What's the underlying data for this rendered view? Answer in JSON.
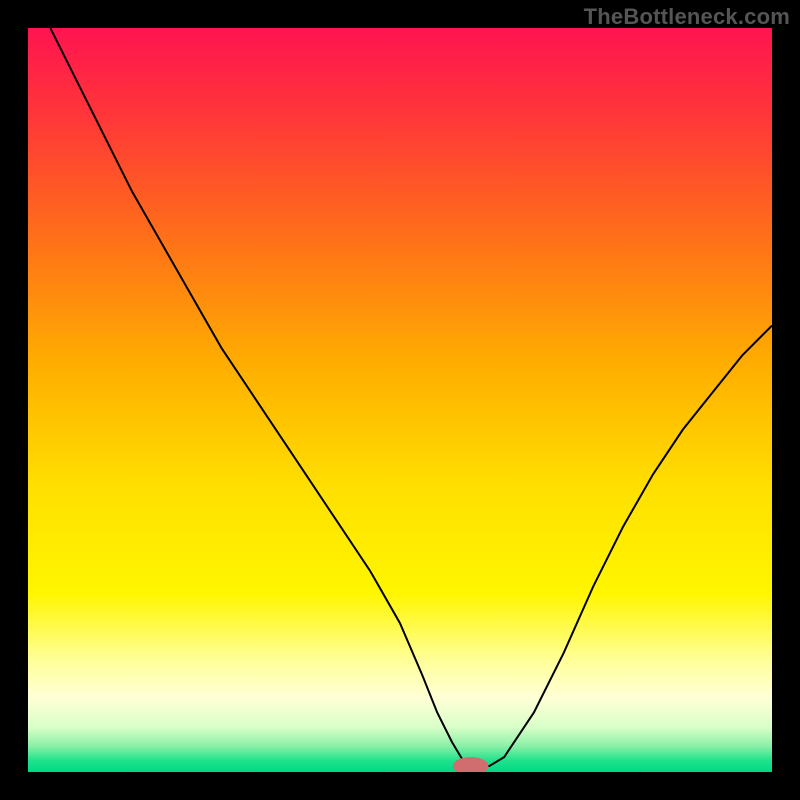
{
  "watermark": "TheBottleneck.com",
  "colors": {
    "frame": "#000000",
    "gradient_stops": [
      {
        "offset": 0.0,
        "color": "#ff1450"
      },
      {
        "offset": 0.12,
        "color": "#ff3738"
      },
      {
        "offset": 0.28,
        "color": "#ff6f19"
      },
      {
        "offset": 0.45,
        "color": "#ffad00"
      },
      {
        "offset": 0.62,
        "color": "#ffe000"
      },
      {
        "offset": 0.76,
        "color": "#fff600"
      },
      {
        "offset": 0.85,
        "color": "#ffff99"
      },
      {
        "offset": 0.9,
        "color": "#ffffd6"
      },
      {
        "offset": 0.94,
        "color": "#d8ffc8"
      },
      {
        "offset": 0.965,
        "color": "#8bf0a8"
      },
      {
        "offset": 0.985,
        "color": "#1ee28c"
      },
      {
        "offset": 1.0,
        "color": "#00d884"
      }
    ],
    "curve": "#000000",
    "marker_fill": "#cf6d6f",
    "marker_stroke": "#cf6d6f"
  },
  "chart_data": {
    "type": "line",
    "title": "",
    "xlabel": "",
    "ylabel": "",
    "xlim": [
      0,
      100
    ],
    "ylim": [
      0,
      100
    ],
    "grid": false,
    "legend": false,
    "x": [
      3,
      6,
      10,
      14,
      18,
      22,
      26,
      30,
      34,
      38,
      42,
      46,
      50,
      53,
      55,
      57,
      58.5,
      60,
      62,
      64,
      68,
      72,
      76,
      80,
      84,
      88,
      92,
      96,
      100
    ],
    "y": [
      100,
      94,
      86,
      78,
      71,
      64,
      57,
      51,
      45,
      39,
      33,
      27,
      20,
      13,
      8,
      4,
      1.5,
      0.8,
      0.8,
      2,
      8,
      16,
      25,
      33,
      40,
      46,
      51,
      56,
      60
    ],
    "marker": {
      "x": 59.5,
      "y": 0.8,
      "rx": 2.3,
      "ry": 1.1
    }
  }
}
